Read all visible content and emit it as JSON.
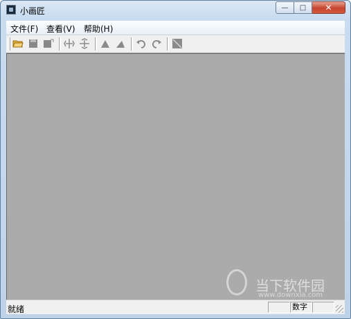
{
  "window": {
    "title": "小画匠"
  },
  "titlebar_buttons": {
    "minimize": "—",
    "maximize": "□",
    "close": "✕"
  },
  "menu": [
    "文件(F)",
    "查看(V)",
    "帮助(H)"
  ],
  "toolbar": {
    "icons": [
      "open-folder-icon",
      "save-icon",
      "save-as-icon",
      "flip-horizontal-icon",
      "flip-vertical-icon",
      "rotate-left-icon",
      "rotate-right-icon",
      "undo-icon",
      "redo-icon",
      "crop-icon"
    ]
  },
  "status": {
    "text": "就绪",
    "num_lock": "数字"
  },
  "watermark": {
    "text": "当下软件园",
    "url": "www.downxia.com"
  }
}
